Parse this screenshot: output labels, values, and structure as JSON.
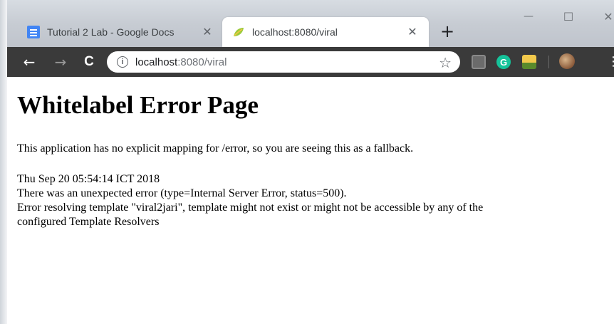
{
  "tabs": [
    {
      "title": "Tutorial 2 Lab - Google Docs",
      "favicon": "google-docs-icon",
      "active": false
    },
    {
      "title": "localhost:8080/viral",
      "favicon": "leaf-icon",
      "active": true
    }
  ],
  "window_controls": {
    "minimize": "—",
    "maximize": "☐",
    "close": "✕"
  },
  "toolbar": {
    "back": "←",
    "forward": "→",
    "reload": "C",
    "url_host": "localhost",
    "url_path": ":8080/viral",
    "star": "☆",
    "ext_g": "G",
    "menu": "⋮"
  },
  "page": {
    "heading": "Whitelabel Error Page",
    "lead": "This application has no explicit mapping for /error, so you are seeing this as a fallback.",
    "timestamp": "Thu Sep 20 05:54:14 ICT 2018",
    "error_line": "There was an unexpected error (type=Internal Server Error, status=500).",
    "message_line1": "Error resolving template \"viral2jari\", template might not exist or might not be accessible by any of the",
    "message_line2": "configured Template Resolvers"
  },
  "colors": {
    "titlebar": "#c7ccd3",
    "toolbar": "#3a3a3a",
    "docs_blue": "#4285f4",
    "grammarly_green": "#15c39a"
  }
}
